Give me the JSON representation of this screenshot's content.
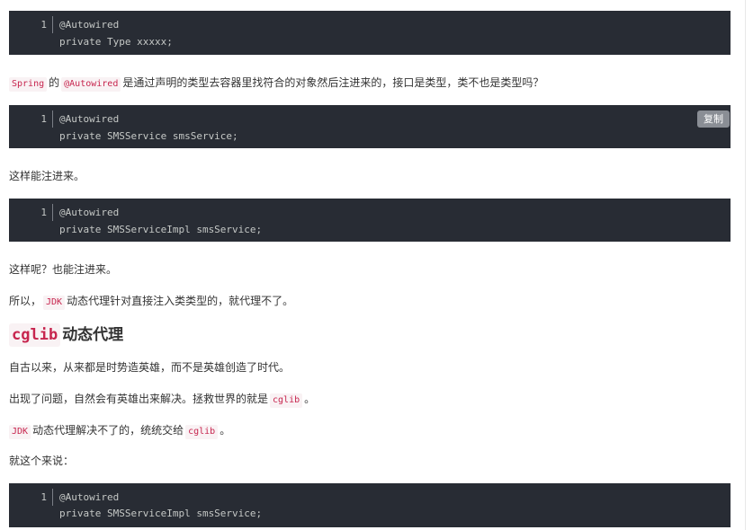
{
  "copy_label": "复制",
  "blocks": [
    {
      "line_no": "1",
      "lines": [
        "@Autowired",
        "private Type xxxxx;"
      ]
    },
    {
      "line_no": "1",
      "lines": [
        "@Autowired",
        "private SMSService smsService;"
      ]
    },
    {
      "line_no": "1",
      "lines": [
        "@Autowired",
        "private SMSServiceImpl smsService;"
      ]
    },
    {
      "line_no": "1",
      "lines": [
        "@Autowired",
        "private SMSServiceImpl smsService;"
      ]
    }
  ],
  "paragraphs": {
    "p1": {
      "code1": "Spring",
      "t1": "的",
      "code2": "@Autowired",
      "t2": "是通过声明的类型去容器里找符合的对象然后注进来的，接口是类型，类不也是类型吗？"
    },
    "p2": "这样能注进来。",
    "p3": "这样呢？也能注进来。",
    "p4": {
      "t1": "所以，",
      "code": "JDK",
      "t2": "动态代理针对直接注入类类型的，就代理不了。"
    },
    "heading": {
      "code": "cglib",
      "text": "动态代理"
    },
    "p5": "自古以来，从来都是时势造英雄，而不是英雄创造了时代。",
    "p6": {
      "t1": "出现了问题，自然会有英雄出来解决。拯救世界的就是",
      "code": "cglib",
      "t2": "。"
    },
    "p7": {
      "code1": "JDK",
      "t1": "动态代理解决不了的，统统交给",
      "code2": "cglib",
      "t2": "。"
    },
    "p8": "就这个来说："
  },
  "colors": {
    "code_bg": "#282c34",
    "inline_code_fg": "#c7254e",
    "inline_code_bg": "#f9f2f4",
    "copy_button_bg": "#8a8e95"
  }
}
